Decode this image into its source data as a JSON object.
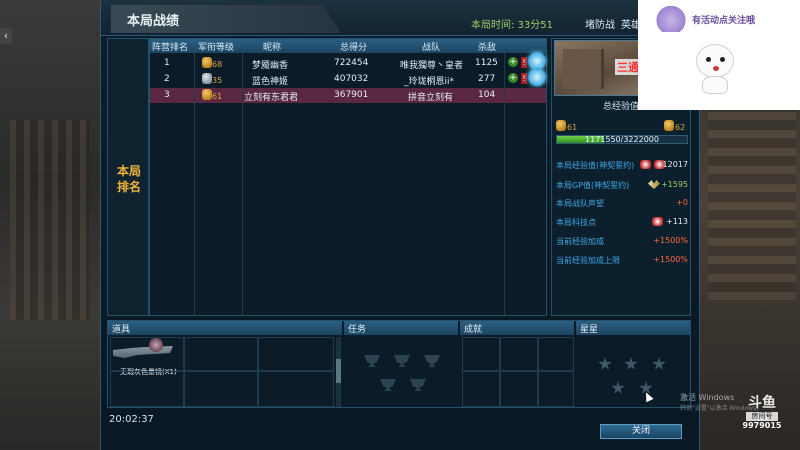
{
  "window": {
    "title": "本局战绩",
    "time_label": "本局时间: 33分51",
    "mode": "堵防战",
    "hero_label": "英雄"
  },
  "side_label": "本局排名",
  "table": {
    "headers": [
      "阵营排名",
      "军衔等级",
      "昵称",
      "总得分",
      "战队",
      "杀敌"
    ],
    "rows": [
      {
        "rank": "1",
        "level": "68",
        "name": "梦魇幽香",
        "score": "722454",
        "team": "唯我獨尊丶皇者",
        "kills": "1125",
        "rank_icon": "gold-rank-icon"
      },
      {
        "rank": "2",
        "level": "35",
        "name": "蓝色神姬",
        "score": "407032",
        "team": "_玲珑桐恩ii*",
        "kills": "277",
        "rank_icon": "silver-rank-icon"
      },
      {
        "rank": "3",
        "level": "61",
        "name": "立刻有东君君",
        "score": "367901",
        "team": "拼音立刻有",
        "kills": "104",
        "rank_icon": "gold-rank-icon"
      }
    ]
  },
  "info": {
    "map_name": "三通关",
    "exp_title": "总经验值",
    "level_from": "61",
    "level_to": "62",
    "exp_text": "1171550/3222000",
    "exp_progress": 0.36,
    "stats": [
      {
        "label": "本局经验值(神契誓约)",
        "value": "12017",
        "style": "white"
      },
      {
        "label": "本局GP值(神契誓约)",
        "value": "+1595",
        "style": "green"
      },
      {
        "label": "本局战队声望",
        "value": "+0",
        "style": "red"
      },
      {
        "label": "本局科技点",
        "value": "+113",
        "style": "white"
      },
      {
        "label": "当前经验加成",
        "value": "+1500%",
        "style": "red"
      },
      {
        "label": "当前经验加成上限",
        "value": "+1500%",
        "style": "red"
      }
    ]
  },
  "bottom": {
    "items_header": "道具",
    "item_name": "无瑕灰色墨镜(X1)",
    "tasks_header": "任务",
    "achievements_header": "成就",
    "stars_header": "星星"
  },
  "footer": {
    "clock": "20:02:37",
    "close_label": "关闭",
    "activate_windows": "激活 Windows",
    "activate_hint": "转到\"设置\"以激活 Windows。"
  },
  "stream": {
    "logo": "斗鱼",
    "room_tag": "房间号",
    "room_number": "9979015",
    "overlay_text": "有活动点关注哦"
  },
  "colors": {
    "accent": "#2b5f82",
    "gold": "#f0b43a",
    "green": "#9ad06a",
    "red": "#ff6a3a",
    "selected_row": "#5a2840"
  }
}
